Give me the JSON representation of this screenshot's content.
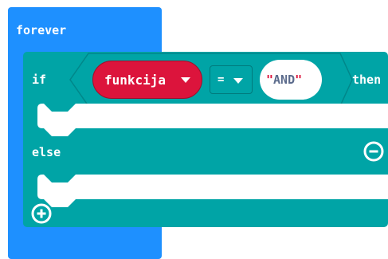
{
  "forever": {
    "label": "forever"
  },
  "if_block": {
    "if_label": "if",
    "then_label": "then",
    "else_label": "else",
    "condition": {
      "variable": "funkcija",
      "operator": "=",
      "string_value": "AND",
      "quote_open": "\"",
      "quote_close": "\""
    }
  },
  "icons": {
    "dropdown": "caret-down-icon",
    "remove_else": "minus-circle-icon",
    "add_branch": "plus-circle-icon"
  },
  "colors": {
    "forever_block": "#1e90ff",
    "if_block": "#00a4a6",
    "variable_block": "#dc143c",
    "string_block": "#ffffff",
    "string_text": "#5b6b8c"
  }
}
